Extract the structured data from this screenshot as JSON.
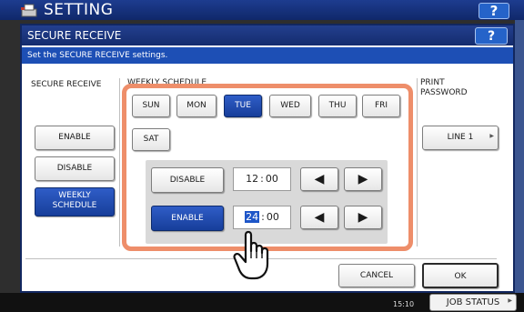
{
  "background": {
    "title": "SETTING",
    "help_label": "?",
    "clock": "15:10",
    "job_status": "JOB STATUS"
  },
  "dialog": {
    "title": "SECURE RECEIVE",
    "help_label": "?",
    "subtitle": "Set the SECURE RECEIVE settings.",
    "sections": {
      "secure_receive": "SECURE RECEIVE",
      "weekly_schedule": "WEEKLY SCHEDULE",
      "print_password_line1": "PRINT",
      "print_password_line2": "PASSWORD"
    },
    "mode_buttons": {
      "enable": "ENABLE",
      "disable": "DISABLE",
      "weekly_line1": "WEEKLY",
      "weekly_line2": "SCHEDULE",
      "selected": "WEEKLY SCHEDULE"
    },
    "days": [
      "SUN",
      "MON",
      "TUE",
      "WED",
      "THU",
      "FRI",
      "SAT"
    ],
    "selected_day": "TUE",
    "schedule": {
      "disable_label": "DISABLE",
      "disable_hour": "12",
      "disable_min": "00",
      "enable_label": "ENABLE",
      "enable_hour": "24",
      "enable_min": "00",
      "separator": ":",
      "left_arrow": "◀",
      "right_arrow": "▶"
    },
    "line_button": "LINE 1",
    "cancel": "CANCEL",
    "ok": "OK"
  },
  "colors": {
    "header_blue": "#1d3c8f",
    "selected_blue": "#1d4fb5",
    "highlight_orange": "#ee8e6a"
  }
}
